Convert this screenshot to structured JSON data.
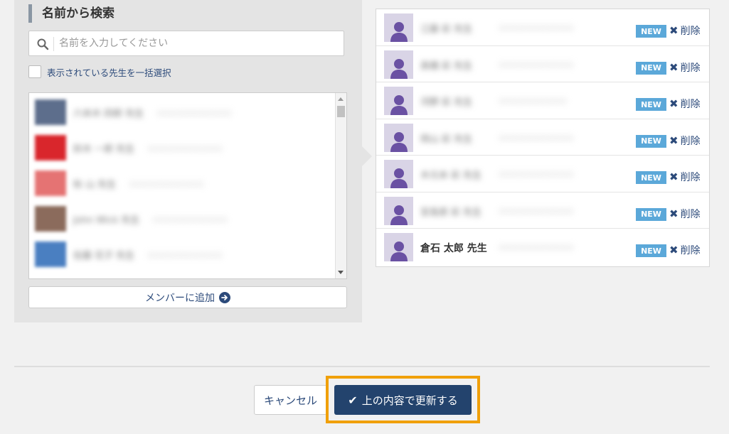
{
  "search_panel": {
    "title": "名前から検索",
    "search_placeholder": "名前を入力してください",
    "select_all_label": "表示されている先生を一括選択",
    "results": [
      {
        "name": "六本木 四郎 先生",
        "sub": "○○○○○○○○○○○",
        "avatar_color": "#5d6e8c"
      },
      {
        "name": "鈴木 一郎 先生",
        "sub": "○○○○○○○○○○○",
        "avatar_color": "#d9262c"
      },
      {
        "name": "秋 山 先生",
        "sub": "○○○○○○○○○○○",
        "avatar_color": "#e57373"
      },
      {
        "name": "John Wick 先生",
        "sub": "○○○○○○○○○○○",
        "avatar_color": "#8b6b5c"
      },
      {
        "name": "佐藤 花子 先生",
        "sub": "○○○○○○○○○○○",
        "avatar_color": "#4a7fc1"
      }
    ],
    "add_member_label": "メンバーに追加"
  },
  "selected_members": {
    "new_badge": "NEW",
    "delete_label": "削除",
    "rows": [
      {
        "name": "江藤 彩 先生",
        "sub": "○○○○○○○○○○○",
        "blurred": true
      },
      {
        "name": "高橋 彩 先生",
        "sub": "○○○○○○○○○○○",
        "blurred": true
      },
      {
        "name": "河野 彩 先生",
        "sub": "○○○○○○○○○○",
        "blurred": true
      },
      {
        "name": "岡山 彩 先生",
        "sub": "○○○○○○○○○○○",
        "blurred": true
      },
      {
        "name": "木元本 彩 先生",
        "sub": "○○○○○○○○○○○",
        "blurred": true
      },
      {
        "name": "宮島原 彩 先生",
        "sub": "○○○○○○○○○○○",
        "blurred": true
      },
      {
        "name": "倉石 太郎 先生",
        "sub": "○○○○○○○○○○○",
        "blurred": false
      }
    ]
  },
  "footer": {
    "cancel_label": "キャンセル",
    "update_label": "上の内容で更新する"
  },
  "colors": {
    "accent": "#23436d",
    "badge": "#5ba8d9",
    "highlight": "#f0a00a",
    "avatar_bg": "#d9d4e6",
    "avatar_fg": "#6a51a3"
  }
}
